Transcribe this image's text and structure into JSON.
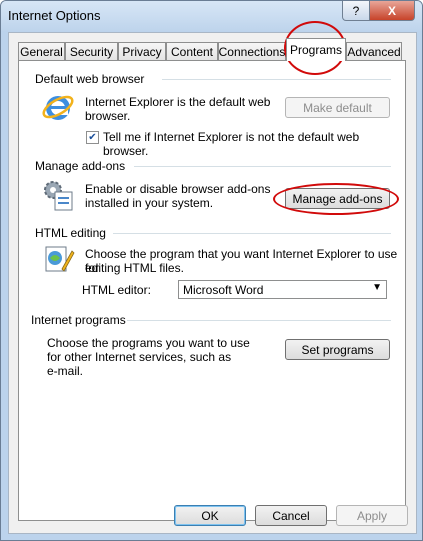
{
  "window": {
    "title": "Internet Options",
    "help_label": "?",
    "close_label": "X"
  },
  "tabs": [
    "General",
    "Security",
    "Privacy",
    "Content",
    "Connections",
    "Programs",
    "Advanced"
  ],
  "default_browser": {
    "heading": "Default web browser",
    "text_line1": "Internet Explorer is the default web",
    "text_line2": "browser.",
    "make_default_label": "Make default",
    "checkbox_label": "Tell me if Internet Explorer is not the default web browser.",
    "checkbox_checked": true,
    "icon": "internet-explorer-icon"
  },
  "addons": {
    "heading": "Manage add-ons",
    "text_line1": "Enable or disable browser add-ons",
    "text_line2": "installed in your system.",
    "button_label": "Manage add-ons",
    "icon": "addons-gear-icon"
  },
  "html_editing": {
    "heading": "HTML editing",
    "text_line1": "Choose the program that you want Internet Explorer to use for",
    "text_line2": "editing HTML files.",
    "editor_label": "HTML editor:",
    "editor_value": "Microsoft Word",
    "icon": "html-edit-icon"
  },
  "internet_programs": {
    "heading": "Internet programs",
    "text_line1": "Choose the programs you want to use",
    "text_line2": "for other Internet services, such as",
    "text_line3": "e-mail.",
    "button_label": "Set programs"
  },
  "footer": {
    "ok_label": "OK",
    "cancel_label": "Cancel",
    "apply_label": "Apply"
  },
  "colors": {
    "annotation_red": "#d10a0a"
  }
}
